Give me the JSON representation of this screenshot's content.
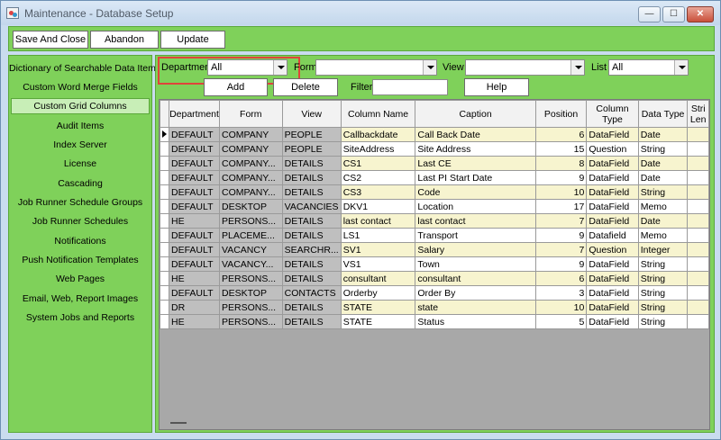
{
  "window": {
    "title": "Maintenance - Database Setup"
  },
  "titlebar_buttons": {
    "minimize": "—",
    "maximize": "☐",
    "close": "✕"
  },
  "toolbar": {
    "save_close": "Save And Close",
    "abandon": "Abandon",
    "update": "Update"
  },
  "sidebar": {
    "items": [
      {
        "label": "Dictionary of Searchable Data Items"
      },
      {
        "label": "Custom Word Merge Fields"
      },
      {
        "label": "Custom Grid Columns"
      },
      {
        "label": "Audit Items"
      },
      {
        "label": "Index Server"
      },
      {
        "label": "License"
      },
      {
        "label": "Cascading"
      },
      {
        "label": "Job Runner Schedule Groups"
      },
      {
        "label": "Job Runner Schedules"
      },
      {
        "label": "Notifications"
      },
      {
        "label": "Push Notification Templates"
      },
      {
        "label": "Web Pages"
      },
      {
        "label": "Email, Web, Report Images"
      },
      {
        "label": "System Jobs and Reports"
      }
    ],
    "active_index": 2
  },
  "filters": {
    "department_label": "Department",
    "department_value": "All",
    "form_label": "Form",
    "form_value": "",
    "view_label": "View",
    "view_value": "",
    "list_label": "List",
    "list_value": "All",
    "filter_label": "Filter",
    "filter_value": ""
  },
  "actions": {
    "add": "Add",
    "delete": "Delete",
    "help": "Help"
  },
  "grid": {
    "columns": [
      "Department",
      "Form",
      "View",
      "Column Name",
      "Caption",
      "Position",
      "Column Type",
      "Data Type",
      "Stri Len"
    ],
    "rows": [
      [
        "DEFAULT",
        "COMPANY",
        "PEOPLE",
        "Callbackdate",
        "Call Back Date",
        "6",
        "DataField",
        "Date"
      ],
      [
        "DEFAULT",
        "COMPANY",
        "PEOPLE",
        "SiteAddress",
        "Site Address",
        "15",
        "Question",
        "String"
      ],
      [
        "DEFAULT",
        "COMPANY...",
        "DETAILS",
        "CS1",
        "Last CE",
        "8",
        "DataField",
        "Date"
      ],
      [
        "DEFAULT",
        "COMPANY...",
        "DETAILS",
        "CS2",
        "Last PI Start Date",
        "9",
        "DataField",
        "Date"
      ],
      [
        "DEFAULT",
        "COMPANY...",
        "DETAILS",
        "CS3",
        "Code",
        "10",
        "DataField",
        "String"
      ],
      [
        "DEFAULT",
        "DESKTOP",
        "VACANCIES",
        "DKV1",
        "Location",
        "17",
        "DataField",
        "Memo"
      ],
      [
        "HE",
        "PERSONS...",
        "DETAILS",
        "last contact",
        "last contact",
        "7",
        "DataField",
        "Date"
      ],
      [
        "DEFAULT",
        "PLACEME...",
        "DETAILS",
        "LS1",
        "Transport",
        "9",
        "Datafield",
        "Memo"
      ],
      [
        "DEFAULT",
        "VACANCY",
        "SEARCHR...",
        "SV1",
        "Salary",
        "7",
        "Question",
        "Integer"
      ],
      [
        "DEFAULT",
        "VACANCY...",
        "DETAILS",
        "VS1",
        "Town",
        "9",
        "DataField",
        "String"
      ],
      [
        "HE",
        "PERSONS...",
        "DETAILS",
        "consultant",
        "consultant",
        "6",
        "DataField",
        "String"
      ],
      [
        "DEFAULT",
        "DESKTOP",
        "CONTACTS",
        "Orderby",
        "Order By",
        "3",
        "DataField",
        "String"
      ],
      [
        "DR",
        "PERSONS...",
        "DETAILS",
        "STATE",
        "state",
        "10",
        "DataField",
        "String"
      ],
      [
        "HE",
        "PERSONS...",
        "DETAILS",
        "STATE",
        "Status",
        "5",
        "DataField",
        "String"
      ]
    ]
  },
  "colors": {
    "panel_green": "#7fd15a",
    "odd_row": "#f7f4cf",
    "highlight_red": "#e0443a"
  }
}
